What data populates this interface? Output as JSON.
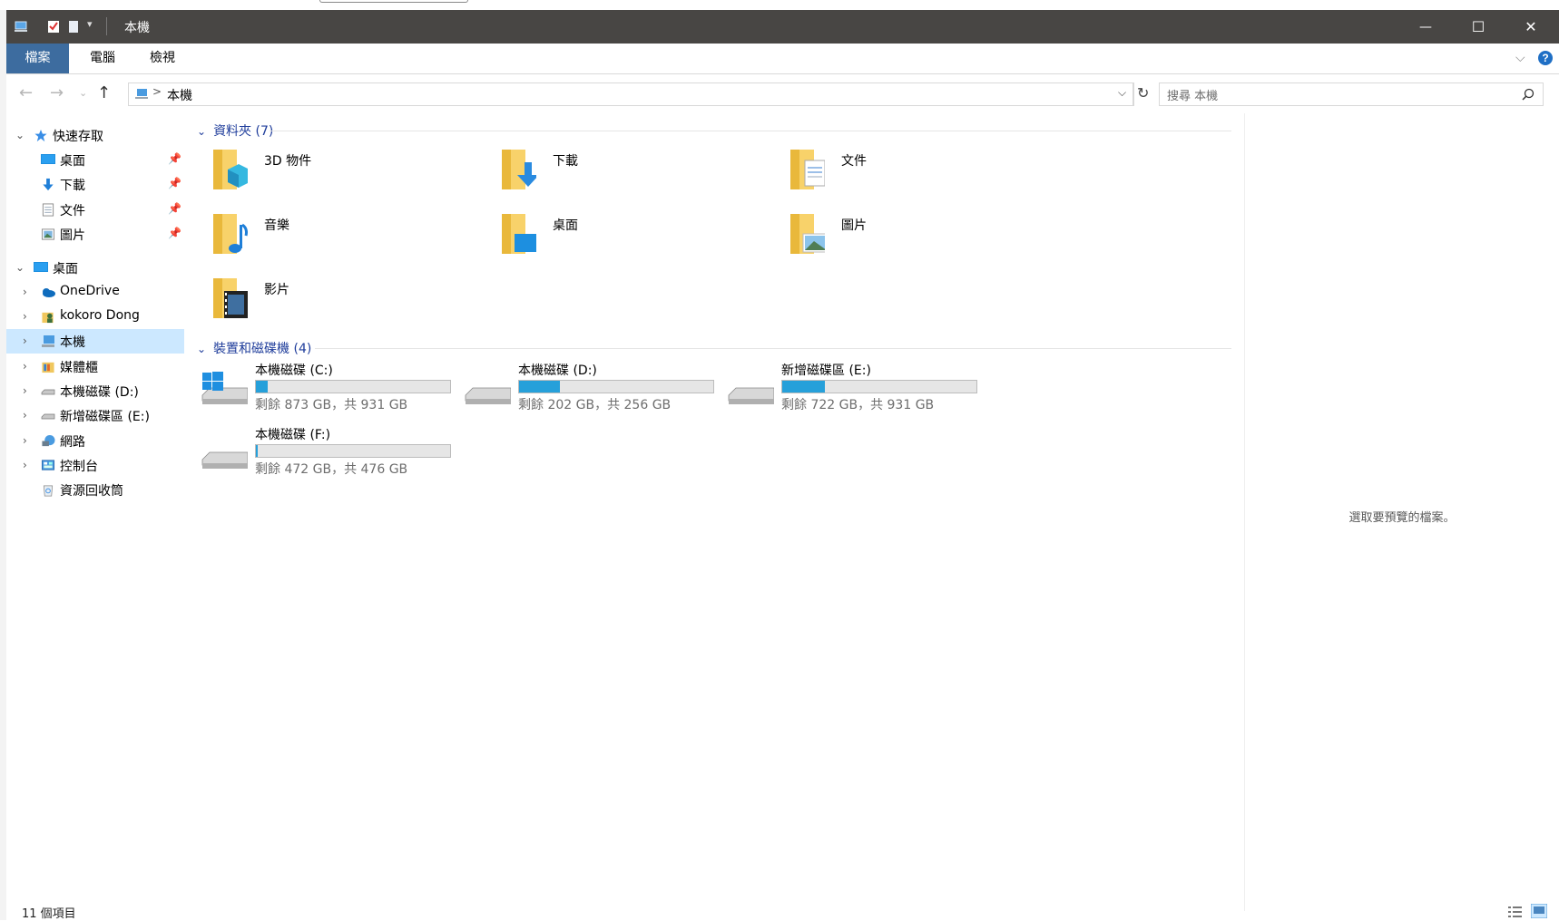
{
  "window": {
    "title": "本機",
    "controls": {
      "minimize": "—",
      "maximize": "☐",
      "close": "✕"
    }
  },
  "ribbon": {
    "tabs": [
      "檔案",
      "電腦",
      "檢視"
    ]
  },
  "address": {
    "path": "本機",
    "separator": ">",
    "search_placeholder": "搜尋 本機"
  },
  "nav": {
    "quick_access": "快速存取",
    "quick_items": [
      "桌面",
      "下載",
      "文件",
      "圖片"
    ],
    "desktop": "桌面",
    "tree_items": [
      "OneDrive",
      "kokoro Dong",
      "本機",
      "媒體櫃",
      "本機磁碟 (D:)",
      "新增磁碟區 (E:)",
      "網路",
      "控制台",
      "資源回收筒"
    ]
  },
  "folders_group": {
    "header": "資料夾 (7)",
    "items": [
      "3D 物件",
      "下載",
      "文件",
      "音樂",
      "桌面",
      "圖片",
      "影片"
    ]
  },
  "drives_group": {
    "header": "裝置和磁碟機 (4)",
    "items": [
      {
        "name": "本機磁碟 (C:)",
        "free": "剩餘 873 GB，共 931 GB",
        "used_fraction": 0.06
      },
      {
        "name": "本機磁碟 (D:)",
        "free": "剩餘 202 GB，共 256 GB",
        "used_fraction": 0.21
      },
      {
        "name": "新增磁碟區 (E:)",
        "free": "剩餘 722 GB，共 931 GB",
        "used_fraction": 0.22
      },
      {
        "name": "本機磁碟 (F:)",
        "free": "剩餘 472 GB，共 476 GB",
        "used_fraction": 0.01
      }
    ]
  },
  "preview": {
    "empty_text": "選取要預覽的檔案。"
  },
  "status": {
    "count": "11 個項目"
  },
  "colors": {
    "titlebar": "#484644",
    "accent": "#26a0da",
    "group_header": "#1f3d9b",
    "selected": "#cce8ff"
  }
}
